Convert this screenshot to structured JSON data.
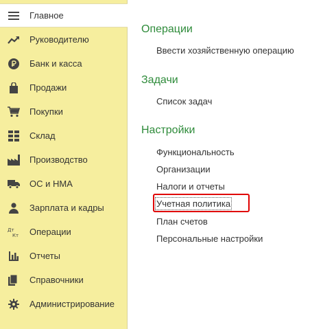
{
  "sidebar": {
    "items": [
      {
        "label": "Главное",
        "icon": "menu-lines-icon",
        "active": true
      },
      {
        "label": "Руководителю",
        "icon": "trend-arrow-icon"
      },
      {
        "label": "Банк и касса",
        "icon": "ruble-coin-icon"
      },
      {
        "label": "Продажи",
        "icon": "shopping-bag-icon"
      },
      {
        "label": "Покупки",
        "icon": "shopping-cart-icon"
      },
      {
        "label": "Склад",
        "icon": "warehouse-grid-icon"
      },
      {
        "label": "Производство",
        "icon": "factory-icon"
      },
      {
        "label": "ОС и НМА",
        "icon": "truck-icon"
      },
      {
        "label": "Зарплата и кадры",
        "icon": "person-icon"
      },
      {
        "label": "Операции",
        "icon": "debit-credit-icon"
      },
      {
        "label": "Отчеты",
        "icon": "bar-chart-icon"
      },
      {
        "label": "Справочники",
        "icon": "books-icon"
      },
      {
        "label": "Администрирование",
        "icon": "gear-icon"
      }
    ],
    "background": "#f6ee9e"
  },
  "main": {
    "sections": [
      {
        "title": "Операции",
        "links": [
          "Ввести хозяйственную операцию"
        ]
      },
      {
        "title": "Задачи",
        "links": [
          "Список задач"
        ]
      },
      {
        "title": "Настройки",
        "links": [
          "Функциональность",
          "Организации",
          "Налоги и отчеты",
          "Учетная политика",
          "План счетов",
          "Персональные настройки"
        ]
      }
    ],
    "section_title_color": "#2e8b3a",
    "highlight_color": "#e00000"
  }
}
